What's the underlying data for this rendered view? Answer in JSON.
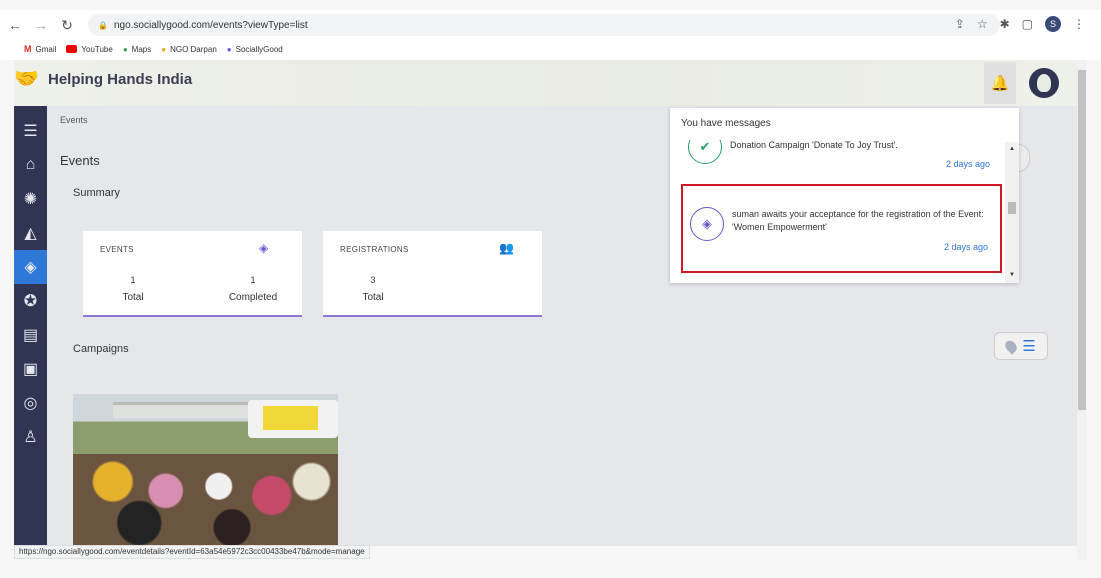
{
  "browser": {
    "url": "ngo.sociallygood.com/events?viewType=list",
    "profile_initial": "S",
    "bookmarks": [
      {
        "label": "Gmail",
        "icon": "gmail-icon"
      },
      {
        "label": "YouTube",
        "icon": "youtube-icon"
      },
      {
        "label": "Maps",
        "icon": "maps-icon"
      },
      {
        "label": "NGO Darpan",
        "icon": "ngo-darpan-icon"
      },
      {
        "label": "SociallyGood",
        "icon": "sociallygood-icon"
      }
    ]
  },
  "header": {
    "brand": "Helping Hands India"
  },
  "breadcrumb": "Events",
  "page_title": "Events",
  "summary_label": "Summary",
  "cards": {
    "events": {
      "label": "EVENTS",
      "m1_value": "1",
      "m1_label": "Total",
      "m2_value": "1",
      "m2_label": "Completed"
    },
    "registrations": {
      "label": "REGISTRATIONS",
      "m1_value": "3",
      "m1_label": "Total"
    }
  },
  "campaigns_label": "Campaigns",
  "notifications": {
    "heading": "You have messages",
    "items": [
      {
        "text": "Donation Campaign 'Donate To Joy Trust'.",
        "time": "2 days ago"
      },
      {
        "text": "suman awaits your acceptance for the registration of the Event: 'Women Empowerment'",
        "time": "2 days ago"
      }
    ]
  },
  "status_url": "https://ngo.sociallygood.com/eventdetails?eventId=63a54e5972c3cc00433be47b&mode=manage",
  "colors": {
    "sidebar": "#2f3552",
    "active": "#2e78d8",
    "accent": "#8d77d3",
    "highlight": "#d0182a"
  }
}
